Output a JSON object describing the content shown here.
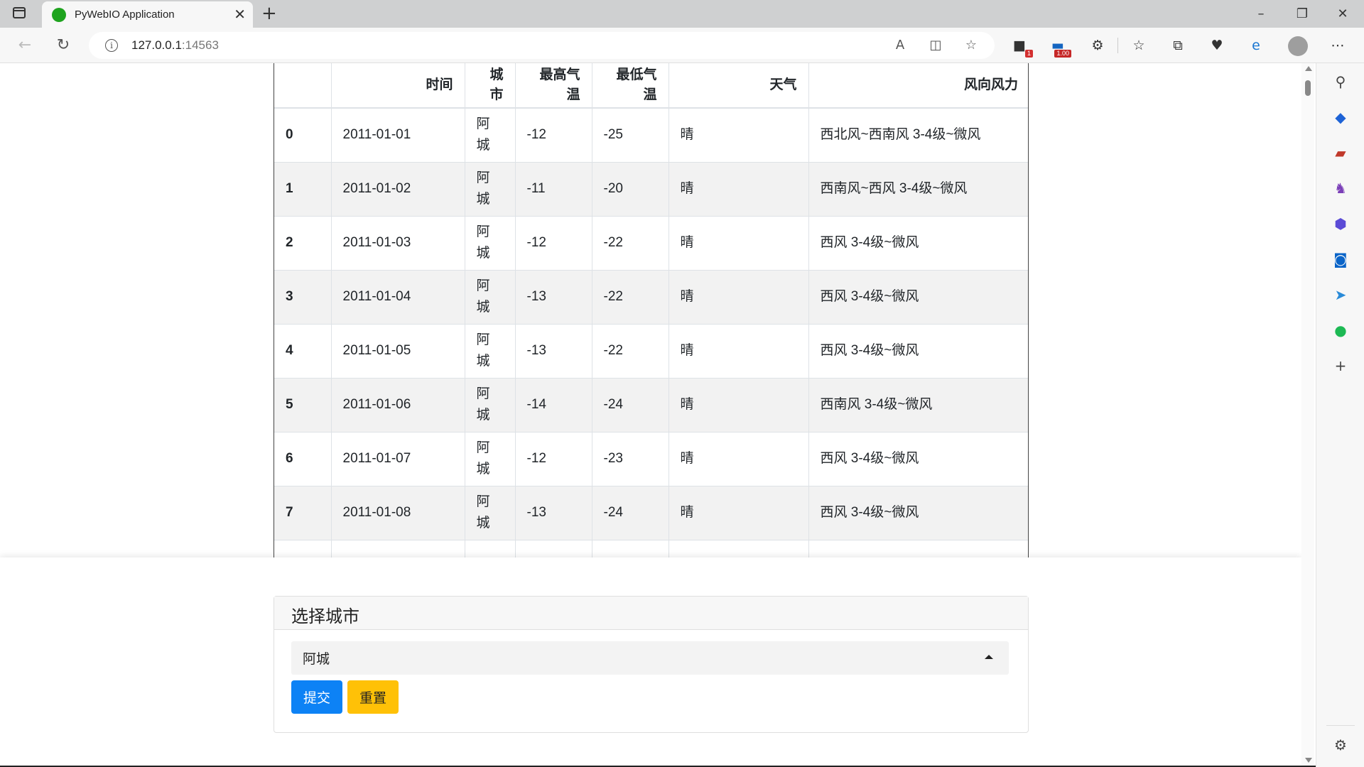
{
  "browser": {
    "tab_title": "PyWebIO Application",
    "url_host": "127.0.0.1",
    "url_port": ":14563",
    "extension_badge_1": "1",
    "extension_badge_2": "1.00"
  },
  "table": {
    "headers": [
      "",
      "时间",
      "城市",
      "最高气温",
      "最低气温",
      "天气",
      "风向风力"
    ],
    "header_lines": {
      "city": [
        "城",
        "市"
      ],
      "high": [
        "最高气",
        "温"
      ],
      "low": [
        "最低气",
        "温"
      ]
    },
    "rows": [
      {
        "idx": "0",
        "time": "2011-01-01",
        "city": [
          "阿",
          "城"
        ],
        "high": "-12",
        "low": "-25",
        "weather": "晴",
        "wind": "西北风~西南风 3-4级~微风"
      },
      {
        "idx": "1",
        "time": "2011-01-02",
        "city": [
          "阿",
          "城"
        ],
        "high": "-11",
        "low": "-20",
        "weather": "晴",
        "wind": "西南风~西风 3-4级~微风"
      },
      {
        "idx": "2",
        "time": "2011-01-03",
        "city": [
          "阿",
          "城"
        ],
        "high": "-12",
        "low": "-22",
        "weather": "晴",
        "wind": "西风 3-4级~微风"
      },
      {
        "idx": "3",
        "time": "2011-01-04",
        "city": [
          "阿",
          "城"
        ],
        "high": "-13",
        "low": "-22",
        "weather": "晴",
        "wind": "西风 3-4级~微风"
      },
      {
        "idx": "4",
        "time": "2011-01-05",
        "city": [
          "阿",
          "城"
        ],
        "high": "-13",
        "low": "-22",
        "weather": "晴",
        "wind": "西风 3-4级~微风"
      },
      {
        "idx": "5",
        "time": "2011-01-06",
        "city": [
          "阿",
          "城"
        ],
        "high": "-14",
        "low": "-24",
        "weather": "晴",
        "wind": "西南风 3-4级~微风"
      },
      {
        "idx": "6",
        "time": "2011-01-07",
        "city": [
          "阿",
          "城"
        ],
        "high": "-12",
        "low": "-23",
        "weather": "晴",
        "wind": "西风 3-4级~微风"
      },
      {
        "idx": "7",
        "time": "2011-01-08",
        "city": [
          "阿",
          "城"
        ],
        "high": "-13",
        "low": "-24",
        "weather": "晴",
        "wind": "西风 3-4级~微风"
      },
      {
        "idx": "",
        "time": "",
        "city": [
          "阿",
          ""
        ],
        "high": "",
        "low": "",
        "weather": "",
        "wind": ""
      }
    ]
  },
  "form": {
    "title": "选择城市",
    "selected_city": "阿城",
    "submit_label": "提交",
    "reset_label": "重置"
  },
  "colors": {
    "submit": "#0d82f5",
    "reset": "#ffc107",
    "favicon": "#1ea31e"
  }
}
